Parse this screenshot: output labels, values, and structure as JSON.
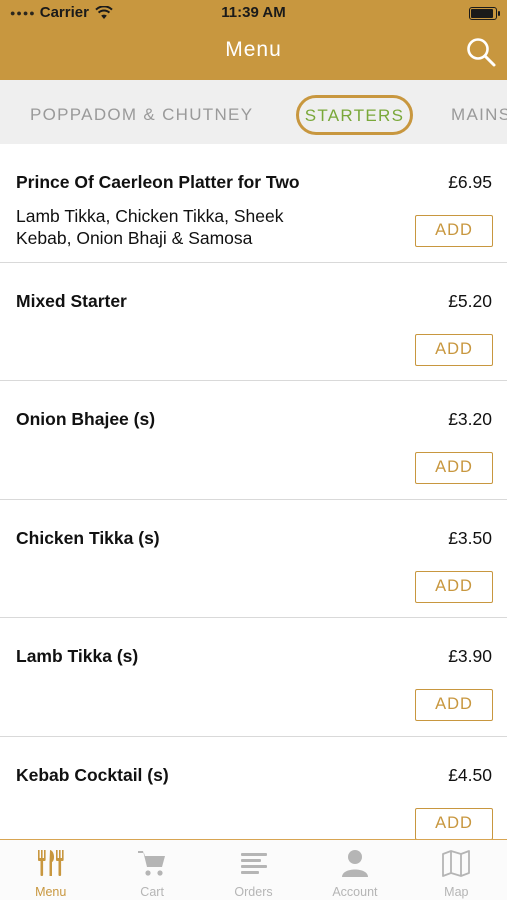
{
  "status_bar": {
    "carrier": "Carrier",
    "time": "11:39 AM"
  },
  "header": {
    "title": "Menu",
    "search_icon": "search-icon"
  },
  "categories": [
    {
      "label": "POPPADOM & CHUTNEY",
      "selected": false
    },
    {
      "label": "STARTERS",
      "selected": true
    },
    {
      "label": "MAINS",
      "selected": false
    }
  ],
  "items": [
    {
      "name": "Prince Of Caerleon Platter for Two",
      "price": "£6.95",
      "description": "Lamb Tikka, Chicken Tikka, Sheek Kebab, Onion Bhaji & Samosa",
      "add_label": "ADD"
    },
    {
      "name": "Mixed Starter",
      "price": "£5.20",
      "description": "",
      "add_label": "ADD"
    },
    {
      "name": "Onion Bhajee (s)",
      "price": "£3.20",
      "description": "",
      "add_label": "ADD"
    },
    {
      "name": "Chicken Tikka (s)",
      "price": "£3.50",
      "description": "",
      "add_label": "ADD"
    },
    {
      "name": "Lamb Tikka (s)",
      "price": "£3.90",
      "description": "",
      "add_label": "ADD"
    },
    {
      "name": "Kebab Cocktail (s)",
      "price": "£4.50",
      "description": "",
      "add_label": "ADD"
    }
  ],
  "tabbar": [
    {
      "label": "Menu",
      "icon": "fork-knife-icon",
      "active": true
    },
    {
      "label": "Cart",
      "icon": "cart-icon",
      "active": false
    },
    {
      "label": "Orders",
      "icon": "list-icon",
      "active": false
    },
    {
      "label": "Account",
      "icon": "person-icon",
      "active": false
    },
    {
      "label": "Map",
      "icon": "map-icon",
      "active": false
    }
  ],
  "colors": {
    "brand": "#c8973f",
    "selected_tab_text": "#7aa83a",
    "inactive": "#b5b5b5"
  }
}
